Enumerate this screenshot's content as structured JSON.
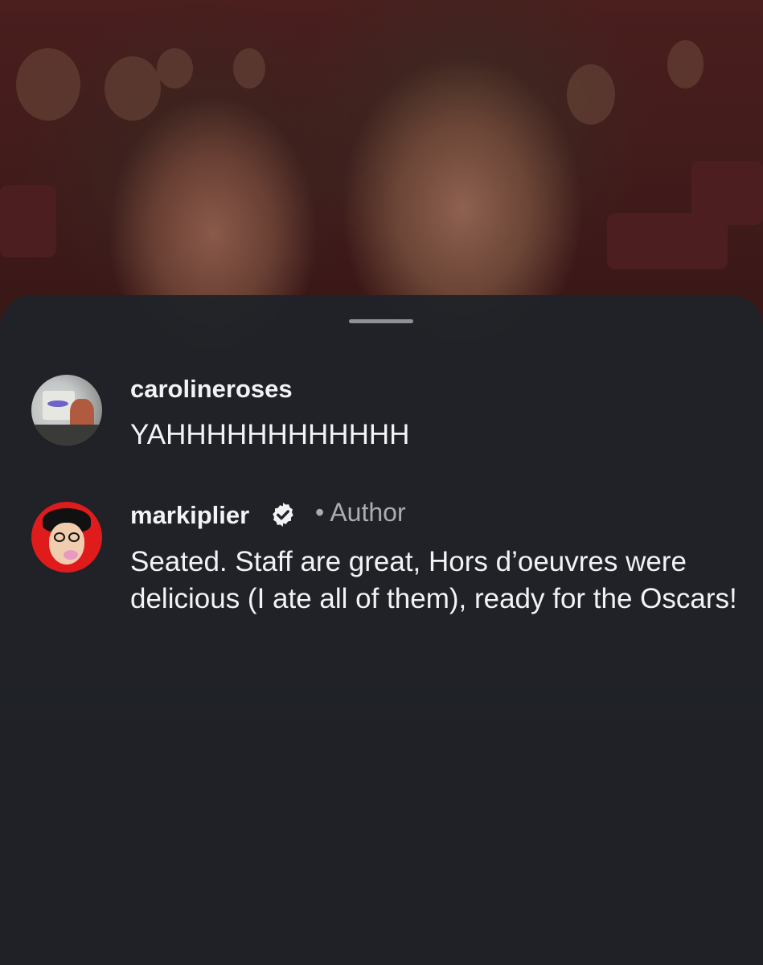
{
  "comments": [
    {
      "username": "carolineroses",
      "text": "YAHHHHHHHHHHHH"
    },
    {
      "username": "markiplier",
      "verified": true,
      "author_label": "• Author",
      "text": "Seated. Staff are great, Hors d’oeuvres were delicious (I ate all of them), ready for the Oscars!"
    }
  ],
  "icons": {
    "verified": "verified-badge-icon",
    "grabber": "sheet-handle"
  }
}
